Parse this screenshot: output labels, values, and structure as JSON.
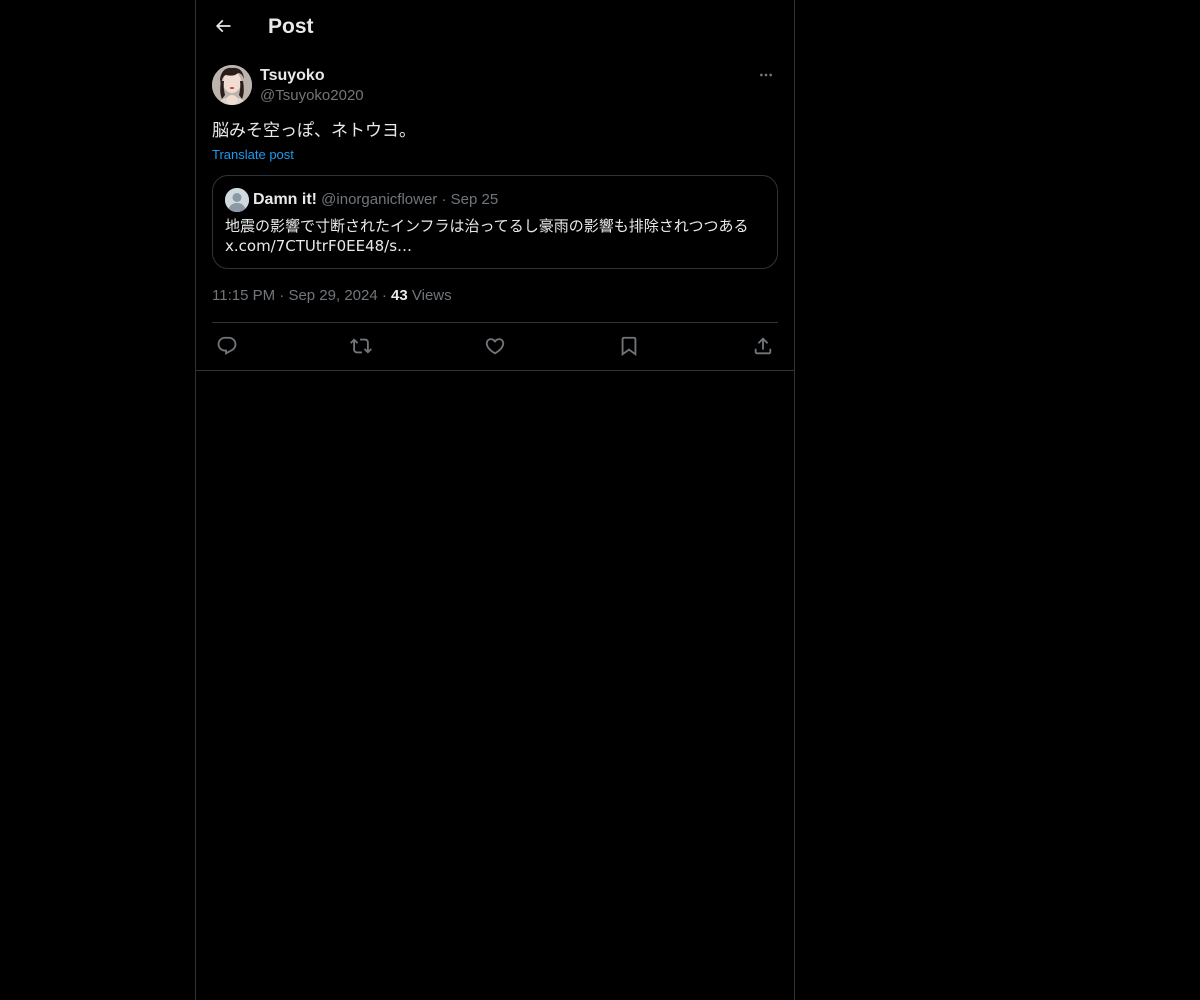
{
  "header": {
    "title": "Post"
  },
  "post": {
    "author_name": "Tsuyoko",
    "author_handle": "@Tsuyoko2020",
    "text": "脳みそ空っぽ、ネトウヨ。",
    "translate_label": "Translate post",
    "time": "11:15 PM",
    "date": "Sep 29, 2024",
    "views_count": "43",
    "views_label": "Views"
  },
  "quote": {
    "author_name": "Damn it!",
    "author_handle": "@inorganicflower",
    "separator": "·",
    "date": "Sep 25",
    "text_line1": "地震の影響で寸断されたインフラは治ってるし豪雨の影響も排除されつつある",
    "text_line2": "x.com/7CTUtrF0EE48/s…"
  },
  "meta": {
    "separator": "·"
  },
  "icons": {
    "back": "arrow-left-icon",
    "more": "more-horizontal-icon",
    "reply": "reply-icon",
    "repost": "repost-icon",
    "like": "heart-icon",
    "bookmark": "bookmark-icon",
    "share": "share-icon"
  },
  "colors": {
    "background": "#000000",
    "text_primary": "#e7e9ea",
    "text_secondary": "#71767b",
    "link": "#1d9bf0",
    "border": "#2f3336"
  }
}
